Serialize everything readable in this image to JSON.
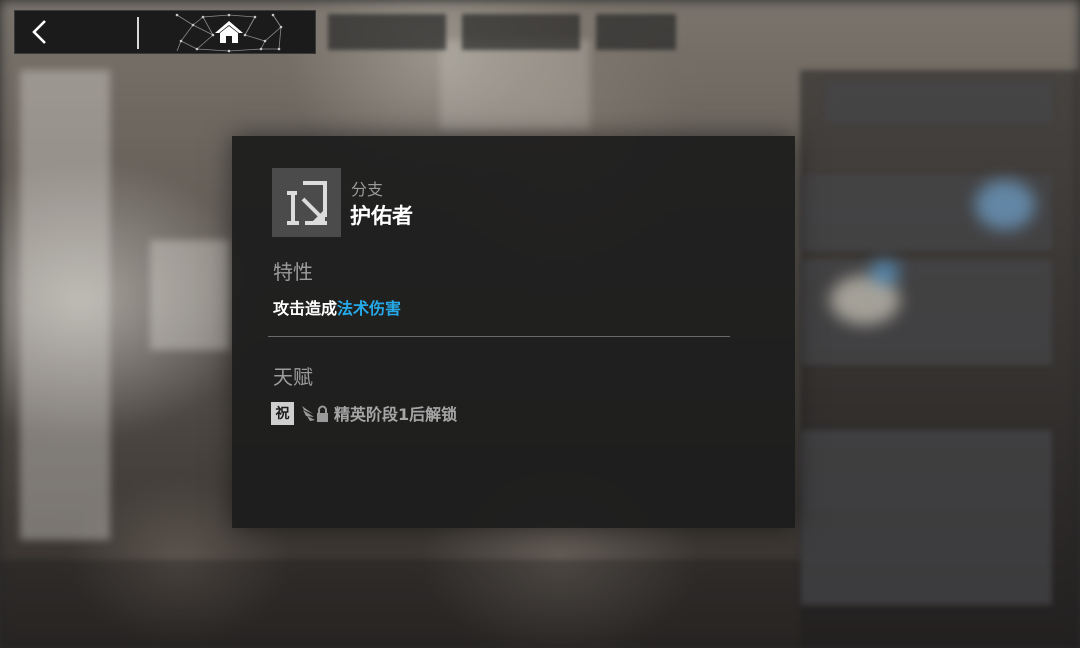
{
  "topbar": {
    "back_icon": "chevron-left-icon",
    "home_icon": "home-icon"
  },
  "branch": {
    "icon": "branch-emblem-icon",
    "subtitle": "分支",
    "name": "护佑者"
  },
  "traits": {
    "title": "特性",
    "text_prefix": "攻击造成",
    "text_highlight": "法术伤害",
    "highlight_color": "#25a9e8"
  },
  "talent": {
    "title": "天赋",
    "tag": "祝",
    "lock_icon": "locked-wing-icon",
    "text": "精英阶段1后解锁"
  }
}
